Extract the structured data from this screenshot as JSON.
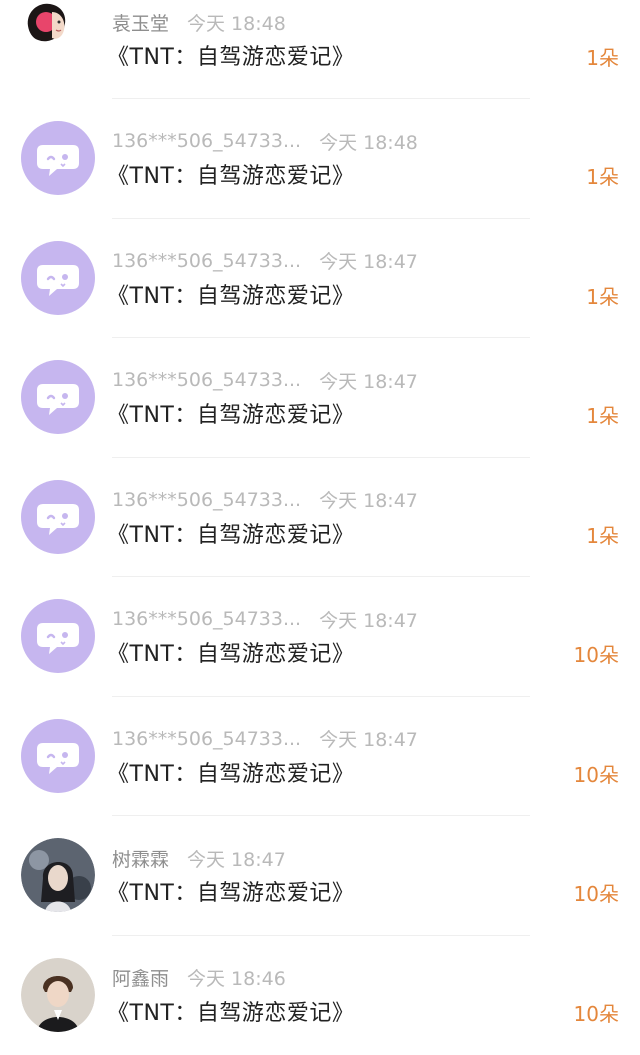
{
  "colors": {
    "accent": "#e4873c",
    "default_avatar": "#c6b6ef",
    "name": "#8e8e8e",
    "muted": "#b9b9b9",
    "title": "#222222"
  },
  "gifts": [
    {
      "name": "袁玉堂",
      "time": "今天 18:48",
      "title": "《TNT：自驾游恋爱记》",
      "count": "1朵",
      "avatar": "user-photo",
      "anon": false
    },
    {
      "name": "136***506_54733...",
      "time": "今天 18:48",
      "title": "《TNT：自驾游恋爱记》",
      "count": "1朵",
      "avatar": "default-chat-avatar",
      "anon": true
    },
    {
      "name": "136***506_54733...",
      "time": "今天 18:47",
      "title": "《TNT：自驾游恋爱记》",
      "count": "1朵",
      "avatar": "default-chat-avatar",
      "anon": true
    },
    {
      "name": "136***506_54733...",
      "time": "今天 18:47",
      "title": "《TNT：自驾游恋爱记》",
      "count": "1朵",
      "avatar": "default-chat-avatar",
      "anon": true
    },
    {
      "name": "136***506_54733...",
      "time": "今天 18:47",
      "title": "《TNT：自驾游恋爱记》",
      "count": "1朵",
      "avatar": "default-chat-avatar",
      "anon": true
    },
    {
      "name": "136***506_54733...",
      "time": "今天 18:47",
      "title": "《TNT：自驾游恋爱记》",
      "count": "10朵",
      "avatar": "default-chat-avatar",
      "anon": true
    },
    {
      "name": "136***506_54733...",
      "time": "今天 18:47",
      "title": "《TNT：自驾游恋爱记》",
      "count": "10朵",
      "avatar": "default-chat-avatar",
      "anon": true
    },
    {
      "name": "树霖霖",
      "time": "今天 18:47",
      "title": "《TNT：自驾游恋爱记》",
      "count": "10朵",
      "avatar": "user-photo",
      "anon": false
    },
    {
      "name": "阿鑫雨",
      "time": "今天 18:46",
      "title": "《TNT：自驾游恋爱记》",
      "count": "10朵",
      "avatar": "user-photo",
      "anon": false
    }
  ]
}
